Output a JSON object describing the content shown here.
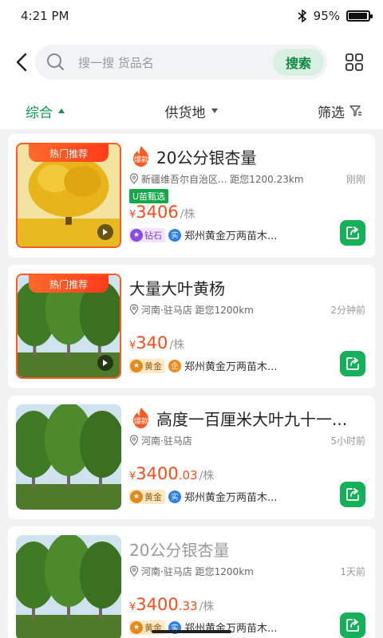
{
  "status": {
    "time": "4:21 PM",
    "battery": "95%",
    "battery_level": 0.95
  },
  "header": {
    "search_placeholder": "搜一搜 货品名",
    "search_button": "搜索"
  },
  "filters": [
    {
      "label": "综合",
      "active": true
    },
    {
      "label": "供货地",
      "active": false
    },
    {
      "label": "筛选",
      "active": false
    }
  ],
  "products": [
    {
      "hot_tag": "热门推荐",
      "has_baokuan": true,
      "baokuan_label": "爆款",
      "title": "20公分银杏量",
      "location": "新疆维吾尔自治区...",
      "distance": "距您1200.23km",
      "time": "刚刚",
      "u_tag": "U苗甄选",
      "price_yen": "¥",
      "price_int": "3406",
      "price_dec": "",
      "price_unit": "/株",
      "level_label": "钻石",
      "level_type": "diamond",
      "cert_label": "实",
      "seller": "郑州黄金万两苗木..."
    },
    {
      "hot_tag": "热门推荐",
      "has_baokuan": false,
      "title": "大量大叶黄杨",
      "location": "河南·驻马店",
      "distance": "距您1200km",
      "time": "2分钟前",
      "price_yen": "¥",
      "price_int": "340",
      "price_dec": "",
      "price_unit": "/株",
      "level_label": "黄金",
      "level_type": "gold",
      "cert_label": "企",
      "seller": "郑州黄金万两苗木..."
    },
    {
      "hot_tag": "",
      "has_baokuan": true,
      "baokuan_label": "爆款",
      "title": "高度一百厘米大叶九十一...",
      "location": "河南·驻马店",
      "distance": "",
      "time": "5小时前",
      "price_yen": "¥",
      "price_int": "3400",
      "price_dec": ".03",
      "price_unit": "/株",
      "level_label": "黄金",
      "level_type": "gold",
      "cert_label": "实",
      "seller": "郑州黄金万两苗木..."
    },
    {
      "hot_tag": "",
      "has_baokuan": false,
      "title": "20公分银杏量",
      "title_grey": true,
      "location": "河南·驻马店",
      "distance": "距您1200km",
      "time": "1天前",
      "price_yen": "¥",
      "price_int": "3400",
      "price_dec": ".33",
      "price_unit": "/株",
      "level_label": "黄金",
      "level_type": "gold",
      "cert_label": "实",
      "seller": "郑州黄金万两苗木..."
    }
  ],
  "colors": {
    "accent": "#0a9a4a",
    "price": "#ff4a17",
    "hot": "#ff5a1f"
  }
}
